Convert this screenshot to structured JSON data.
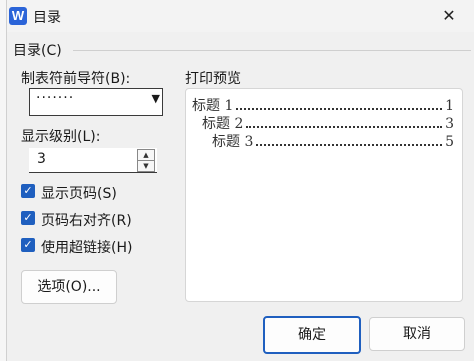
{
  "dialog": {
    "title": "目录",
    "app_icon_letter": "W",
    "close_glyph": "✕"
  },
  "toc_group": {
    "label": "目录(C)"
  },
  "leader": {
    "label": "制表符前导符(B):",
    "value": "·······"
  },
  "levels": {
    "label": "显示级别(L):",
    "value": "3"
  },
  "options": [
    {
      "label": "显示页码(S)",
      "checked": true
    },
    {
      "label": "页码右对齐(R)",
      "checked": true
    },
    {
      "label": "使用超链接(H)",
      "checked": true
    }
  ],
  "preview": {
    "label": "打印预览",
    "entries": [
      {
        "title": "标题 1",
        "page": "1"
      },
      {
        "title": "标题 2",
        "page": "3"
      },
      {
        "title": "标题 3",
        "page": "5"
      }
    ]
  },
  "buttons": {
    "options": "选项(O)...",
    "ok": "确定",
    "cancel": "取消"
  },
  "colors": {
    "accent": "#1f5fbf",
    "dialog_bg": "#f0f0f0"
  }
}
